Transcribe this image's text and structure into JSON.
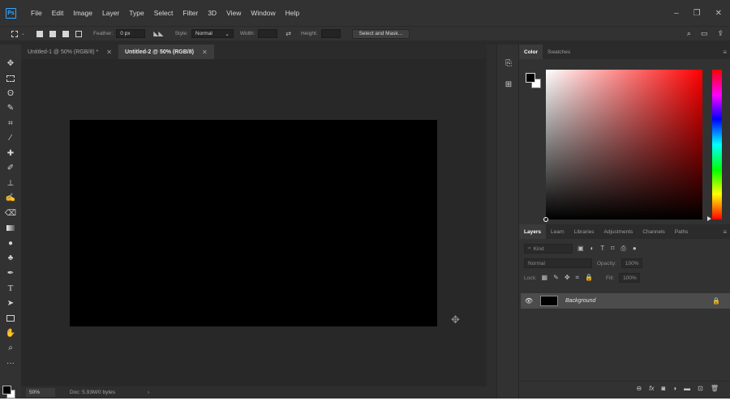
{
  "app": {
    "logo": "Ps"
  },
  "menu": [
    "File",
    "Edit",
    "Image",
    "Layer",
    "Type",
    "Select",
    "Filter",
    "3D",
    "View",
    "Window",
    "Help"
  ],
  "window_controls": {
    "minimize": "–",
    "restore": "❐",
    "close": "✕"
  },
  "options_bar": {
    "feather_label": "Feather:",
    "feather_value": "0 px",
    "style_label": "Style:",
    "style_value": "Normal",
    "width_label": "Width:",
    "height_label": "Height:",
    "select_mask_label": "Select and Mask..."
  },
  "tabs": [
    {
      "label": "Untitled-1 @ 50% (RGB/8) *",
      "close": "✕",
      "active": false
    },
    {
      "label": "Untitled-2 @ 50% (RGB/8)",
      "close": "✕",
      "active": true
    }
  ],
  "status": {
    "zoom": "50%",
    "doc_info": "Doc: 5.93M/0 bytes",
    "arrow": "›"
  },
  "color_panel": {
    "tabs": [
      "Color",
      "Swatches"
    ],
    "foreground": "#000000",
    "background": "#ffffff",
    "hue_color": "#ff0000"
  },
  "layers_panel": {
    "tabs": [
      "Layers",
      "Learn",
      "Libraries",
      "Adjustments",
      "Channels",
      "Paths"
    ],
    "kind_placeholder": "Kind",
    "blend_mode": "Normal",
    "opacity_label": "Opacity:",
    "opacity_value": "100%",
    "lock_label": "Lock:",
    "fill_label": "Fill:",
    "fill_value": "100%",
    "layers": [
      {
        "name": "Background",
        "visible": true,
        "locked": true
      }
    ]
  },
  "icons": {
    "tools": [
      "move-icon",
      "marquee-icon",
      "lasso-icon",
      "quick-select-icon",
      "crop-icon",
      "eyedropper-icon",
      "healing-brush-icon",
      "brush-icon",
      "clone-stamp-icon",
      "history-brush-icon",
      "eraser-icon",
      "gradient-icon",
      "blur-icon",
      "dodge-icon",
      "pen-icon",
      "type-icon",
      "path-select-icon",
      "rectangle-icon",
      "hand-icon",
      "zoom-icon",
      "more-tools-icon"
    ]
  }
}
